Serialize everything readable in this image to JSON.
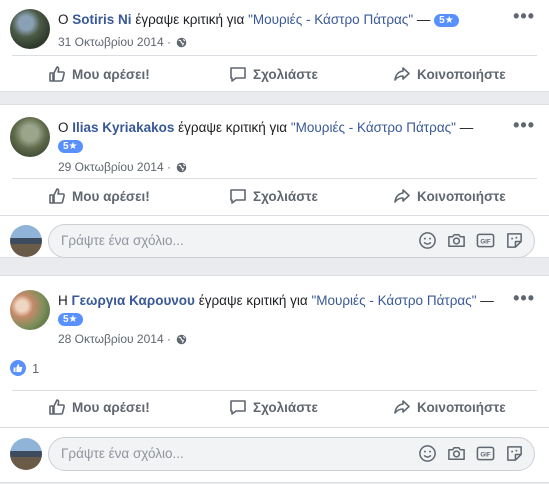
{
  "reviews": [
    {
      "prefix": "Ο",
      "author": "Sotiris Ni",
      "verb": "έγραψε κριτική για",
      "page": "\"Μουριές - Κάστρο Πάτρας\"",
      "dash": "—",
      "rating": "5★",
      "date": "31 Οκτωβρίου 2014",
      "like_label": "Μου αρέσει!",
      "comment_label": "Σχολιάστε",
      "share_label": "Κοινοποιήστε"
    },
    {
      "prefix": "Ο",
      "author": "Ilias Kyriakakos",
      "verb": "έγραψε κριτική για",
      "page": "\"Μουριές - Κάστρο Πάτρας\"",
      "dash": "—",
      "rating": "5★",
      "date": "29 Οκτωβρίου 2014",
      "like_label": "Μου αρέσει!",
      "comment_label": "Σχολιάστε",
      "share_label": "Κοινοποιήστε",
      "comment_placeholder": "Γράψτε ένα σχόλιο..."
    },
    {
      "prefix": "Η",
      "author": "Γεωργια Καρουνου",
      "verb": "έγραψε κριτική για",
      "page": "\"Μουριές - Κάστρο Πάτρας\"",
      "dash": "—",
      "rating": "5★",
      "date": "28 Οκτωβρίου 2014",
      "reaction_count": "1",
      "like_label": "Μου αρέσει!",
      "comment_label": "Σχολιάστε",
      "share_label": "Κοινοποιήστε",
      "comment_placeholder": "Γράψτε ένα σχόλιο..."
    }
  ],
  "icons": {
    "privacy": "globe-icon",
    "more": "more-options-icon",
    "like": "thumbs-up-icon",
    "comment": "comment-bubble-icon",
    "share": "share-arrow-icon",
    "emoji": "emoji-icon",
    "camera": "camera-icon",
    "gif": "gif-icon",
    "sticker": "sticker-icon"
  },
  "colors": {
    "link": "#385898",
    "badge": "#5890ff",
    "muted": "#606770",
    "background": "#e9ebee"
  }
}
